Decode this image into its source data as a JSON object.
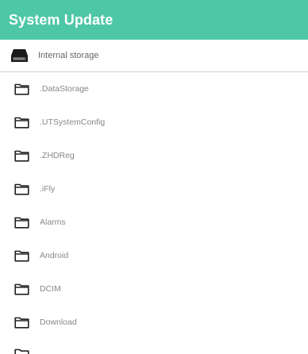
{
  "app_bar": {
    "title": "System Update",
    "background_color": "#4ec7a7"
  },
  "storage": {
    "label": "Internal storage",
    "icon": "drive-icon"
  },
  "folders": [
    {
      "name": ".DataStorage",
      "icon": "folder-icon"
    },
    {
      "name": ".UTSystemConfig",
      "icon": "folder-icon"
    },
    {
      "name": ".ZHDReg",
      "icon": "folder-icon"
    },
    {
      "name": ".iFly",
      "icon": "folder-icon"
    },
    {
      "name": "Alarms",
      "icon": "folder-icon"
    },
    {
      "name": "Android",
      "icon": "folder-icon"
    },
    {
      "name": "DCIM",
      "icon": "folder-icon"
    },
    {
      "name": "Download",
      "icon": "folder-icon"
    }
  ]
}
